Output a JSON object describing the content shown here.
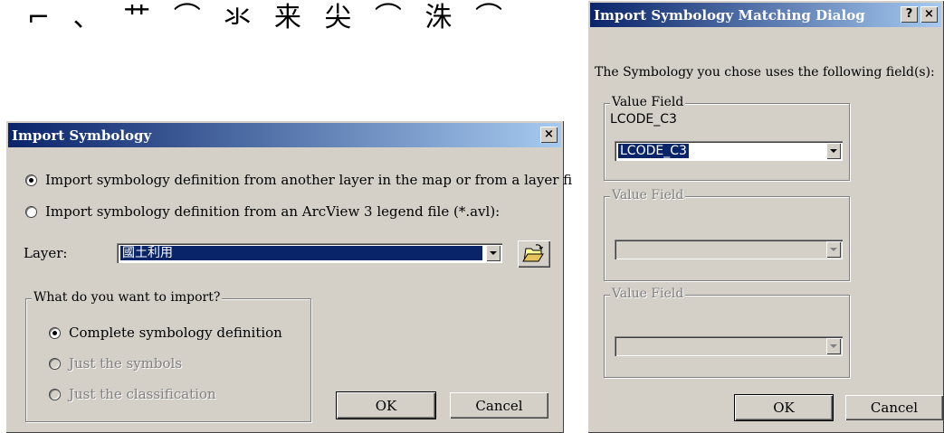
{
  "caption": "⌐ 、 艹 ⌒ 氺 来 尖 ⌒ 洙 ⌒",
  "import_dialog": {
    "title": "Import Symbology",
    "close_glyph": "×",
    "options": [
      {
        "label": "Import symbology definition from another layer in the map or from a layer fi",
        "checked": true
      },
      {
        "label": "Import symbology definition from an ArcView 3 legend file (*.avl):",
        "checked": false
      }
    ],
    "layer_label": "Layer:",
    "layer_value": "國土利用",
    "group_title": "What do you want to import?",
    "import_choices": [
      {
        "label": "Complete symbology definition",
        "checked": true,
        "enabled": true
      },
      {
        "label": "Just the symbols",
        "checked": false,
        "enabled": false
      },
      {
        "label": "Just the classification",
        "checked": false,
        "enabled": false
      }
    ],
    "ok_label": "OK",
    "cancel_label": "Cancel"
  },
  "matching_dialog": {
    "title": "Import Symbology Matching Dialog",
    "help_glyph": "?",
    "close_glyph": "×",
    "intro": "The Symbology you chose uses the following field(s):",
    "fields": [
      {
        "group_title": "Value Field",
        "field_name": "LCODE_C3",
        "combo_value": "LCODE_C3",
        "enabled": true
      },
      {
        "group_title": "Value Field",
        "field_name": "",
        "combo_value": "",
        "enabled": false
      },
      {
        "group_title": "Value Field",
        "field_name": "",
        "combo_value": "",
        "enabled": false
      }
    ],
    "ok_label": "OK",
    "cancel_label": "Cancel"
  },
  "colors": {
    "face": "#d4d0c8",
    "title_start": "#0a246a",
    "title_end": "#a6caf0",
    "selection": "#0a246a"
  }
}
